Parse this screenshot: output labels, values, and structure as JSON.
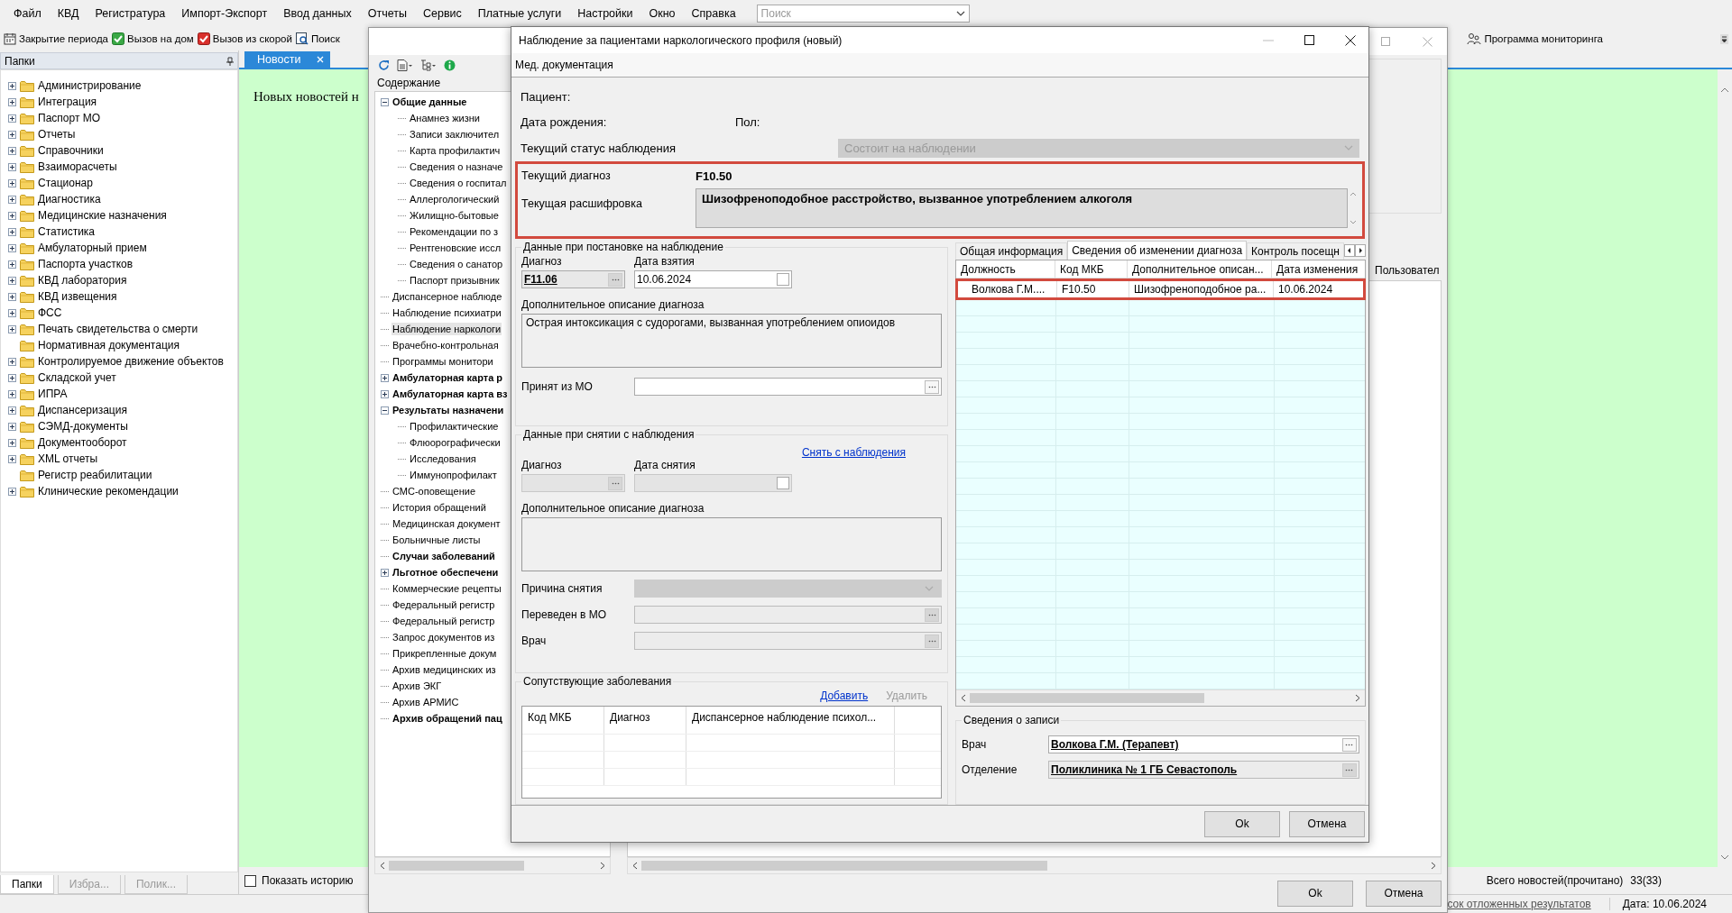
{
  "menu": [
    "Файл",
    "КВД",
    "Регистратура",
    "Импорт-Экспорт",
    "Ввод данных",
    "Отчеты",
    "Сервис",
    "Платные услуги",
    "Настройки",
    "Окно",
    "Справка"
  ],
  "search": {
    "placeholder": "Поиск"
  },
  "toolbar": [
    {
      "kind": "period",
      "label": "Закрытие периода"
    },
    {
      "kind": "home",
      "label": "Вызов на дом"
    },
    {
      "kind": "ambulance",
      "label": "Вызов из скорой"
    },
    {
      "kind": "search",
      "label": "Поиск"
    }
  ],
  "toolbar_right": {
    "label": "Программа мониторинга"
  },
  "sidebar": {
    "title": "Папки",
    "items": [
      {
        "label": "Администрирование",
        "expandable": true
      },
      {
        "label": "Интеграция",
        "expandable": true
      },
      {
        "label": "Паспорт МО",
        "expandable": true
      },
      {
        "label": "Отчеты",
        "expandable": true
      },
      {
        "label": "Справочники",
        "expandable": true
      },
      {
        "label": "Взаиморасчеты",
        "expandable": true
      },
      {
        "label": "Стационар",
        "expandable": true
      },
      {
        "label": "Диагностика",
        "expandable": true
      },
      {
        "label": "Медицинские назначения",
        "expandable": true
      },
      {
        "label": "Статистика",
        "expandable": true
      },
      {
        "label": "Амбулаторный прием",
        "expandable": true
      },
      {
        "label": "Паспорта участков",
        "expandable": true
      },
      {
        "label": "КВД лаборатория",
        "expandable": true
      },
      {
        "label": "КВД извещения",
        "expandable": true
      },
      {
        "label": "ФСС",
        "expandable": true
      },
      {
        "label": "Печать свидетельства о смерти",
        "expandable": true
      },
      {
        "label": "Нормативная документация",
        "expandable": false
      },
      {
        "label": "Контролируемое движение объектов",
        "expandable": true
      },
      {
        "label": "Складской учет",
        "expandable": true
      },
      {
        "label": "ИПРА",
        "expandable": true
      },
      {
        "label": "Диспансеризация",
        "expandable": true
      },
      {
        "label": "СЭМД-документы",
        "expandable": true
      },
      {
        "label": "Документооборот",
        "expandable": true
      },
      {
        "label": "XML отчеты",
        "expandable": true
      },
      {
        "label": "Регистр реабилитации",
        "expandable": false
      },
      {
        "label": "Клинические рекомендации",
        "expandable": true
      }
    ],
    "tabs": [
      {
        "label": "Папки",
        "selected": true
      },
      {
        "label": "Избра...",
        "selected": false
      },
      {
        "label": "Полик...",
        "selected": false
      }
    ]
  },
  "news": {
    "tab": "Новости",
    "message": "Новых новостей н",
    "show_history": {
      "label": "Показать историю",
      "checked": false
    },
    "total_label": "Всего новостей(прочитано)",
    "total_value": "33(33)"
  },
  "status_bar": {
    "link": "сок отложенных результатов",
    "date": "Дата: 10.06.2024"
  },
  "record_window": {
    "contents_title": "Содержание",
    "tree": [
      {
        "label": "Общие данные",
        "bold": true,
        "selected": false,
        "expanded": true,
        "children": [
          {
            "label": "Анамнез жизни",
            "bold": false,
            "selected": false
          },
          {
            "label": "Записи заключител",
            "bold": false,
            "selected": false
          },
          {
            "label": "Карта профилактич",
            "bold": false,
            "selected": false
          },
          {
            "label": "Сведения о назначе",
            "bold": false,
            "selected": false
          },
          {
            "label": "Сведения о госпитал",
            "bold": false,
            "selected": false
          },
          {
            "label": "Аллергологический",
            "bold": false,
            "selected": false
          },
          {
            "label": "Жилищно-бытовые",
            "bold": false,
            "selected": false
          },
          {
            "label": "Рекомендации по з",
            "bold": false,
            "selected": false
          },
          {
            "label": "Рентгеновские иссл",
            "bold": false,
            "selected": false
          },
          {
            "label": "Сведения о санатор",
            "bold": false,
            "selected": false
          },
          {
            "label": "Паспорт призывник",
            "bold": false,
            "selected": false
          }
        ]
      },
      {
        "label": "Диспансерное наблюде",
        "bold": false,
        "selected": false
      },
      {
        "label": "Наблюдение психиатри",
        "bold": false,
        "selected": false
      },
      {
        "label": "Наблюдение наркологи",
        "bold": false,
        "selected": true
      },
      {
        "label": "Врачебно-контрольная",
        "bold": false,
        "selected": false
      },
      {
        "label": "Программы монитори",
        "bold": false,
        "selected": false
      },
      {
        "label": "Амбулаторная карта р",
        "bold": true,
        "selected": false,
        "expanded": false
      },
      {
        "label": "Амбулаторная карта вз",
        "bold": true,
        "selected": false,
        "expanded": false
      },
      {
        "label": "Результаты назначени",
        "bold": true,
        "selected": false,
        "expanded": true,
        "children": [
          {
            "label": "Профилактические",
            "bold": false,
            "selected": false
          },
          {
            "label": "Флюорографически",
            "bold": false,
            "selected": false
          },
          {
            "label": "Исследования",
            "bold": false,
            "selected": false
          },
          {
            "label": "Иммунопрофилакт",
            "bold": false,
            "selected": false
          }
        ]
      },
      {
        "label": "СМС-оповещение",
        "bold": false,
        "selected": false
      },
      {
        "label": "История обращений",
        "bold": false,
        "selected": false
      },
      {
        "label": "Медицинская документ",
        "bold": false,
        "selected": false
      },
      {
        "label": "Больничные листы",
        "bold": false,
        "selected": false
      },
      {
        "label": "Случаи заболеваний",
        "bold": true,
        "selected": false
      },
      {
        "label": "Льготное обеспечени",
        "bold": true,
        "selected": false,
        "expanded": false
      },
      {
        "label": "Коммерческие рецепты",
        "bold": false,
        "selected": false
      },
      {
        "label": "Федеральный регистр",
        "bold": false,
        "selected": false
      },
      {
        "label": "Федеральный регистр",
        "bold": false,
        "selected": false
      },
      {
        "label": "Запрос документов из",
        "bold": false,
        "selected": false
      },
      {
        "label": "Прикрепленные докум",
        "bold": false,
        "selected": false
      },
      {
        "label": "Архив медицинских из",
        "bold": false,
        "selected": false
      },
      {
        "label": "Архив ЭКГ",
        "bold": false,
        "selected": false
      },
      {
        "label": "Архив АРМИС",
        "bold": false,
        "selected": false
      },
      {
        "label": "Архив обращений пац",
        "bold": true,
        "selected": false
      }
    ],
    "side_tab": "Пользовател",
    "buttons": [
      "Ok",
      "Отмена"
    ]
  },
  "dialog": {
    "title": "Наблюдение за пациентами наркологического профиля (новый)",
    "menu": [
      "Мед. документация"
    ],
    "patient_label": "Пациент:",
    "birth_label": "Дата рождения:",
    "sex_label": "Пол:",
    "status": {
      "label": "Текущий статус наблюдения",
      "value": "Состоит на наблюдении",
      "disabled": true
    },
    "current": {
      "highlighted": true,
      "diagnosis_label": "Текущий диагноз",
      "diagnosis": "F10.50",
      "decoding_label": "Текущая расшифровка",
      "decoding": "Шизофреноподобное расстройство, вызванное употреблением алкоголя"
    },
    "registration": {
      "title": "Данные при постановке на наблюдение",
      "diagnosis_label": "Диагноз",
      "diagnosis": "F11.06",
      "date_label": "Дата взятия",
      "date": "10.06.2024",
      "description_label": "Дополнительное описание диагноза",
      "description": "Острая интоксикация с судорогами, вызванная употреблением опиоидов",
      "from_mo_label": "Принят из МО"
    },
    "deregistration": {
      "title": "Данные при снятии с наблюдения",
      "link": "Снять с наблюдения",
      "diagnosis_label": "Диагноз",
      "date_label": "Дата снятия",
      "disabled": true,
      "description_label": "Дополнительное описание диагноза",
      "fields": [
        {
          "label": "Причина снятия",
          "kind": "combo",
          "disabled": true
        },
        {
          "label": "Переведен в МО",
          "kind": "lookup",
          "disabled": true
        },
        {
          "label": "Врач",
          "kind": "lookup",
          "disabled": true
        }
      ]
    },
    "comorbid": {
      "title": "Сопутствующие заболевания",
      "actions": [
        {
          "label": "Добавить",
          "disabled": false
        },
        {
          "label": "Удалить",
          "disabled": true
        }
      ],
      "columns": [
        "Код МКБ",
        "Диагноз",
        "Диспансерное наблюдение психол..."
      ]
    },
    "tabs": [
      {
        "label": "Общая информация",
        "selected": false
      },
      {
        "label": "Сведения об изменении диагноза",
        "selected": true
      },
      {
        "label": "Контроль посещн",
        "selected": false
      }
    ],
    "history": {
      "columns": [
        "Должность",
        "Код МКБ",
        "Дополнительное описан...",
        "Дата изменения"
      ],
      "rows": [
        {
          "cells": [
            "Волкова Г.М....",
            "F10.50",
            "Шизофреноподобное ра...",
            "10.06.2024"
          ],
          "highlighted": true
        }
      ]
    },
    "record": {
      "title": "Сведения о записи",
      "doctor_label": "Врач",
      "doctor": "Волкова Г.М. (Терапевт)",
      "department_label": "Отделение",
      "department": "Поликлиника № 1 ГБ Севастополь",
      "department_disabled": true
    },
    "buttons": [
      "Ok",
      "Отмена"
    ]
  }
}
